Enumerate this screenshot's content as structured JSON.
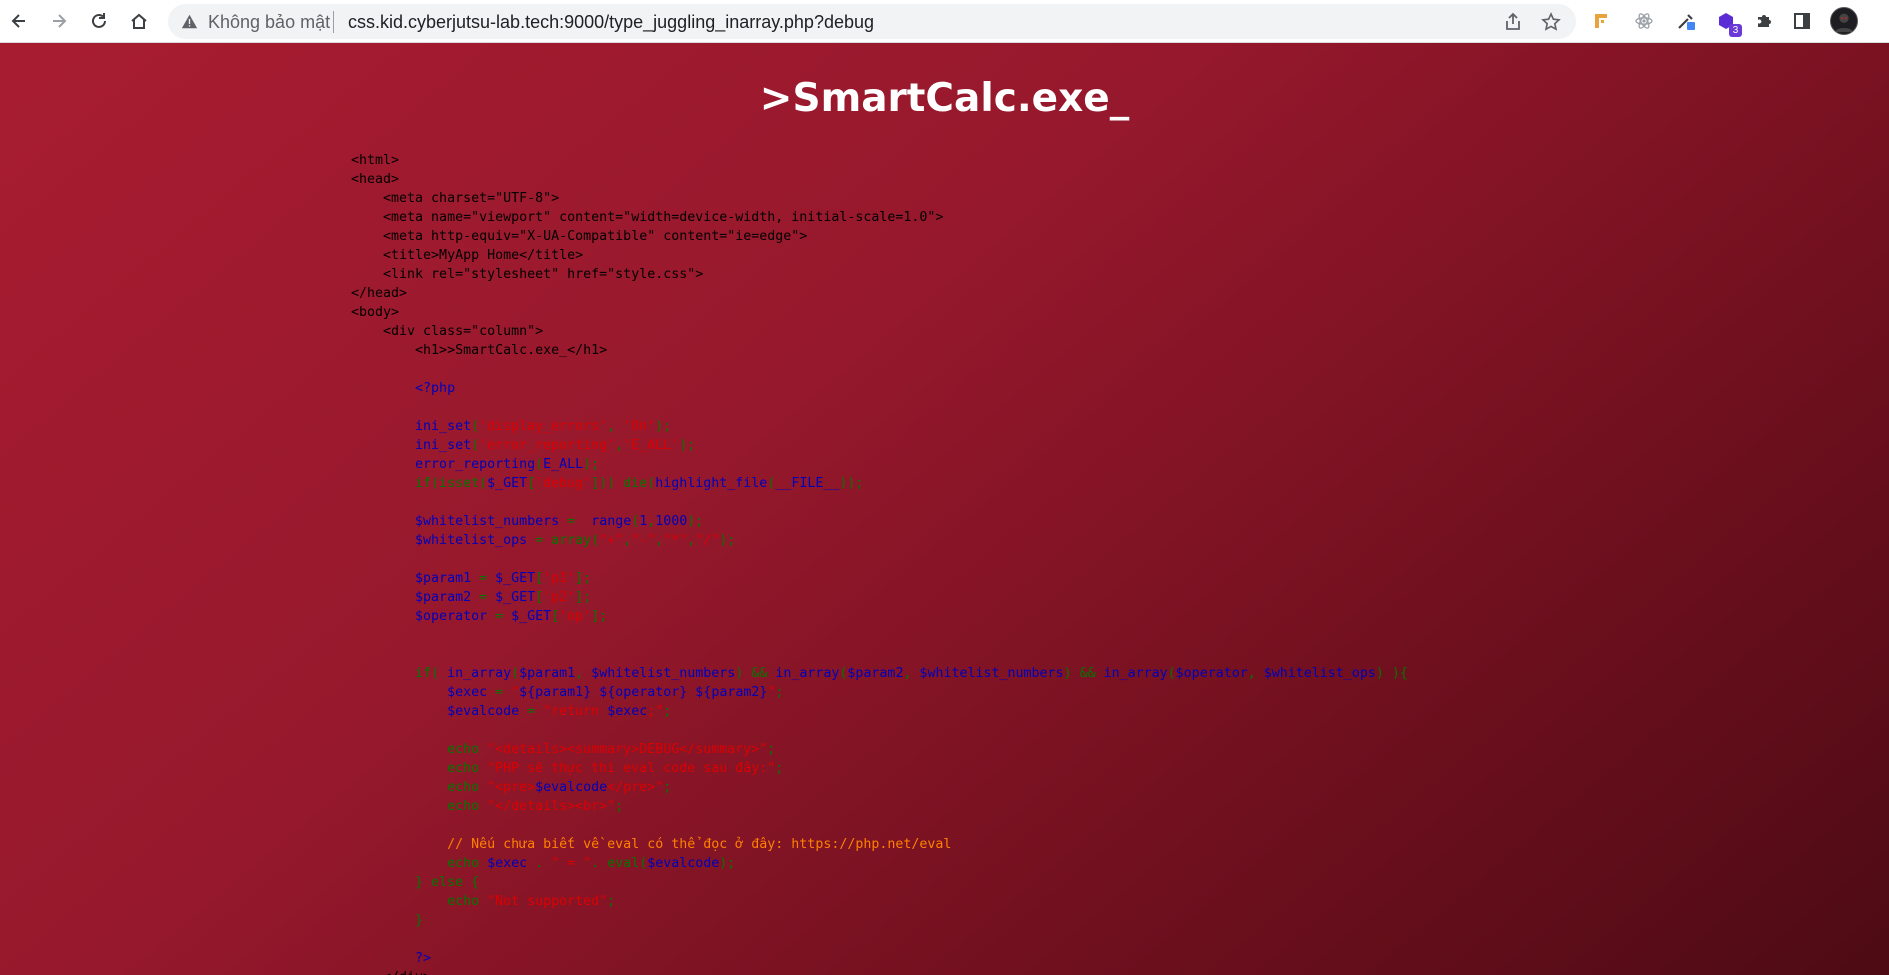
{
  "browser": {
    "security_label": "Không bảo mật",
    "url": "css.kid.cyberjutsu-lab.tech:9000/type_juggling_inarray.php?debug",
    "extension_badge": "3",
    "icons": [
      "back-icon",
      "forward-icon",
      "reload-icon",
      "home-icon",
      "warning-icon",
      "share-icon",
      "star-icon",
      "extension-icon",
      "puzzle-icon",
      "sidepanel-icon",
      "avatar"
    ]
  },
  "page": {
    "heading": ">SmartCalc.exe_",
    "colors": {
      "background_start": "#a81c31",
      "background_end": "#4d0b14",
      "keyword": "#007700",
      "default": "#0000bb",
      "string": "#dd0000",
      "comment": "#ff8000",
      "html": "#000000"
    }
  },
  "source_lines": [
    [
      {
        "t": "<html>",
        "c": "b"
      }
    ],
    [
      {
        "t": "<head>",
        "c": "b"
      }
    ],
    [
      {
        "t": "    <meta charset=\"UTF-8\">",
        "c": "b"
      }
    ],
    [
      {
        "t": "    <meta name=\"viewport\" content=\"width=device-width, initial-scale=1.0\">",
        "c": "b"
      }
    ],
    [
      {
        "t": "    <meta http-equiv=\"X-UA-Compatible\" content=\"ie=edge\">",
        "c": "b"
      }
    ],
    [
      {
        "t": "    <title>MyApp Home</title>",
        "c": "b"
      }
    ],
    [
      {
        "t": "    <link rel=\"stylesheet\" href=\"style.css\">",
        "c": "b"
      }
    ],
    [
      {
        "t": "</head>",
        "c": "b"
      }
    ],
    [
      {
        "t": "<body>",
        "c": "b"
      }
    ],
    [
      {
        "t": "    <div class=\"column\">",
        "c": "b"
      }
    ],
    [
      {
        "t": "        <h1>>SmartCalc.exe_</h1>",
        "c": "b"
      }
    ],
    [],
    [
      {
        "t": "        <?php",
        "c": "d"
      }
    ],
    [],
    [
      {
        "t": "        ini_set",
        "c": "d"
      },
      {
        "t": "(",
        "c": "k"
      },
      {
        "t": "'display_errors'",
        "c": "s"
      },
      {
        "t": ", ",
        "c": "k"
      },
      {
        "t": "'On'",
        "c": "s"
      },
      {
        "t": ");",
        "c": "k"
      }
    ],
    [
      {
        "t": "        ini_set",
        "c": "d"
      },
      {
        "t": "(",
        "c": "k"
      },
      {
        "t": "'error_reporting'",
        "c": "s"
      },
      {
        "t": ",",
        "c": "k"
      },
      {
        "t": "'E_ALL'",
        "c": "s"
      },
      {
        "t": ");",
        "c": "k"
      }
    ],
    [
      {
        "t": "        error_reporting",
        "c": "d"
      },
      {
        "t": "(",
        "c": "k"
      },
      {
        "t": "E_ALL",
        "c": "d"
      },
      {
        "t": ");",
        "c": "k"
      }
    ],
    [
      {
        "t": "        if(isset(",
        "c": "k"
      },
      {
        "t": "$_GET",
        "c": "d"
      },
      {
        "t": "[",
        "c": "k"
      },
      {
        "t": "'debug'",
        "c": "s"
      },
      {
        "t": "])) die(",
        "c": "k"
      },
      {
        "t": "highlight_file",
        "c": "d"
      },
      {
        "t": "(",
        "c": "k"
      },
      {
        "t": "__FILE__",
        "c": "d"
      },
      {
        "t": "));",
        "c": "k"
      }
    ],
    [],
    [
      {
        "t": "        $whitelist_numbers ",
        "c": "d"
      },
      {
        "t": "=  ",
        "c": "k"
      },
      {
        "t": "range",
        "c": "d"
      },
      {
        "t": "(",
        "c": "k"
      },
      {
        "t": "1",
        "c": "d"
      },
      {
        "t": ",",
        "c": "k"
      },
      {
        "t": "1000",
        "c": "d"
      },
      {
        "t": ");",
        "c": "k"
      }
    ],
    [
      {
        "t": "        $whitelist_ops ",
        "c": "d"
      },
      {
        "t": "= array(",
        "c": "k"
      },
      {
        "t": "\"+\"",
        "c": "s"
      },
      {
        "t": ",",
        "c": "k"
      },
      {
        "t": "\"-\"",
        "c": "s"
      },
      {
        "t": ",",
        "c": "k"
      },
      {
        "t": "\"*\"",
        "c": "s"
      },
      {
        "t": ",",
        "c": "k"
      },
      {
        "t": "\"/\"",
        "c": "s"
      },
      {
        "t": ");",
        "c": "k"
      }
    ],
    [],
    [
      {
        "t": "        $param1 ",
        "c": "d"
      },
      {
        "t": "= ",
        "c": "k"
      },
      {
        "t": "$_GET",
        "c": "d"
      },
      {
        "t": "[",
        "c": "k"
      },
      {
        "t": "'p1'",
        "c": "s"
      },
      {
        "t": "];",
        "c": "k"
      }
    ],
    [
      {
        "t": "        $param2 ",
        "c": "d"
      },
      {
        "t": "= ",
        "c": "k"
      },
      {
        "t": "$_GET",
        "c": "d"
      },
      {
        "t": "[",
        "c": "k"
      },
      {
        "t": "'p2'",
        "c": "s"
      },
      {
        "t": "];",
        "c": "k"
      }
    ],
    [
      {
        "t": "        $operator ",
        "c": "d"
      },
      {
        "t": "= ",
        "c": "k"
      },
      {
        "t": "$_GET",
        "c": "d"
      },
      {
        "t": "[",
        "c": "k"
      },
      {
        "t": "'op'",
        "c": "s"
      },
      {
        "t": "];",
        "c": "k"
      }
    ],
    [],
    [],
    [
      {
        "t": "        if( ",
        "c": "k"
      },
      {
        "t": "in_array",
        "c": "d"
      },
      {
        "t": "(",
        "c": "k"
      },
      {
        "t": "$param1",
        "c": "d"
      },
      {
        "t": ", ",
        "c": "k"
      },
      {
        "t": "$whitelist_numbers",
        "c": "d"
      },
      {
        "t": ") && ",
        "c": "k"
      },
      {
        "t": "in_array",
        "c": "d"
      },
      {
        "t": "(",
        "c": "k"
      },
      {
        "t": "$param2",
        "c": "d"
      },
      {
        "t": ", ",
        "c": "k"
      },
      {
        "t": "$whitelist_numbers",
        "c": "d"
      },
      {
        "t": ") && ",
        "c": "k"
      },
      {
        "t": "in_array",
        "c": "d"
      },
      {
        "t": "(",
        "c": "k"
      },
      {
        "t": "$operator",
        "c": "d"
      },
      {
        "t": ", ",
        "c": "k"
      },
      {
        "t": "$whitelist_ops",
        "c": "d"
      },
      {
        "t": ") ){",
        "c": "k"
      }
    ],
    [
      {
        "t": "            $exec ",
        "c": "d"
      },
      {
        "t": "= ",
        "c": "k"
      },
      {
        "t": "\"",
        "c": "s"
      },
      {
        "t": "${",
        "c": "d"
      },
      {
        "t": "param1",
        "c": "d"
      },
      {
        "t": "} ",
        "c": "d"
      },
      {
        "t": "${",
        "c": "d"
      },
      {
        "t": "operator",
        "c": "d"
      },
      {
        "t": "} ",
        "c": "d"
      },
      {
        "t": "${",
        "c": "d"
      },
      {
        "t": "param2",
        "c": "d"
      },
      {
        "t": "}",
        "c": "d"
      },
      {
        "t": "\"",
        "c": "s"
      },
      {
        "t": ";",
        "c": "k"
      }
    ],
    [
      {
        "t": "            $evalcode ",
        "c": "d"
      },
      {
        "t": "= ",
        "c": "k"
      },
      {
        "t": "\"return ",
        "c": "s"
      },
      {
        "t": "$exec",
        "c": "d"
      },
      {
        "t": ";\"",
        "c": "s"
      },
      {
        "t": ";",
        "c": "k"
      }
    ],
    [],
    [
      {
        "t": "            echo ",
        "c": "k"
      },
      {
        "t": "\"<details><summary>DEBUG</summary>\"",
        "c": "s"
      },
      {
        "t": ";",
        "c": "k"
      }
    ],
    [
      {
        "t": "            echo ",
        "c": "k"
      },
      {
        "t": "\"PHP sẽ thực thi eval code sau đây:\"",
        "c": "s"
      },
      {
        "t": ";",
        "c": "k"
      }
    ],
    [
      {
        "t": "            echo ",
        "c": "k"
      },
      {
        "t": "\"<pre>",
        "c": "s"
      },
      {
        "t": "$evalcode",
        "c": "d"
      },
      {
        "t": "</pre>\"",
        "c": "s"
      },
      {
        "t": ";",
        "c": "k"
      }
    ],
    [
      {
        "t": "            echo ",
        "c": "k"
      },
      {
        "t": "\"</details><br>\"",
        "c": "s"
      },
      {
        "t": ";",
        "c": "k"
      }
    ],
    [],
    [
      {
        "t": "            // Nếu chưa biết về eval có thể đọc ở đây: https://php.net/eval",
        "c": "c"
      }
    ],
    [
      {
        "t": "            echo ",
        "c": "k"
      },
      {
        "t": "$exec ",
        "c": "d"
      },
      {
        "t": ". ",
        "c": "k"
      },
      {
        "t": "\" = \"",
        "c": "s"
      },
      {
        "t": ". eval(",
        "c": "k"
      },
      {
        "t": "$evalcode",
        "c": "d"
      },
      {
        "t": ");",
        "c": "k"
      }
    ],
    [
      {
        "t": "        } else {",
        "c": "k"
      }
    ],
    [
      {
        "t": "            echo ",
        "c": "k"
      },
      {
        "t": "\"Not supported\"",
        "c": "s"
      },
      {
        "t": ";",
        "c": "k"
      }
    ],
    [
      {
        "t": "        }",
        "c": "k"
      }
    ],
    [],
    [
      {
        "t": "        ?>",
        "c": "d"
      }
    ],
    [
      {
        "t": "    </div>",
        "c": "b"
      }
    ]
  ]
}
